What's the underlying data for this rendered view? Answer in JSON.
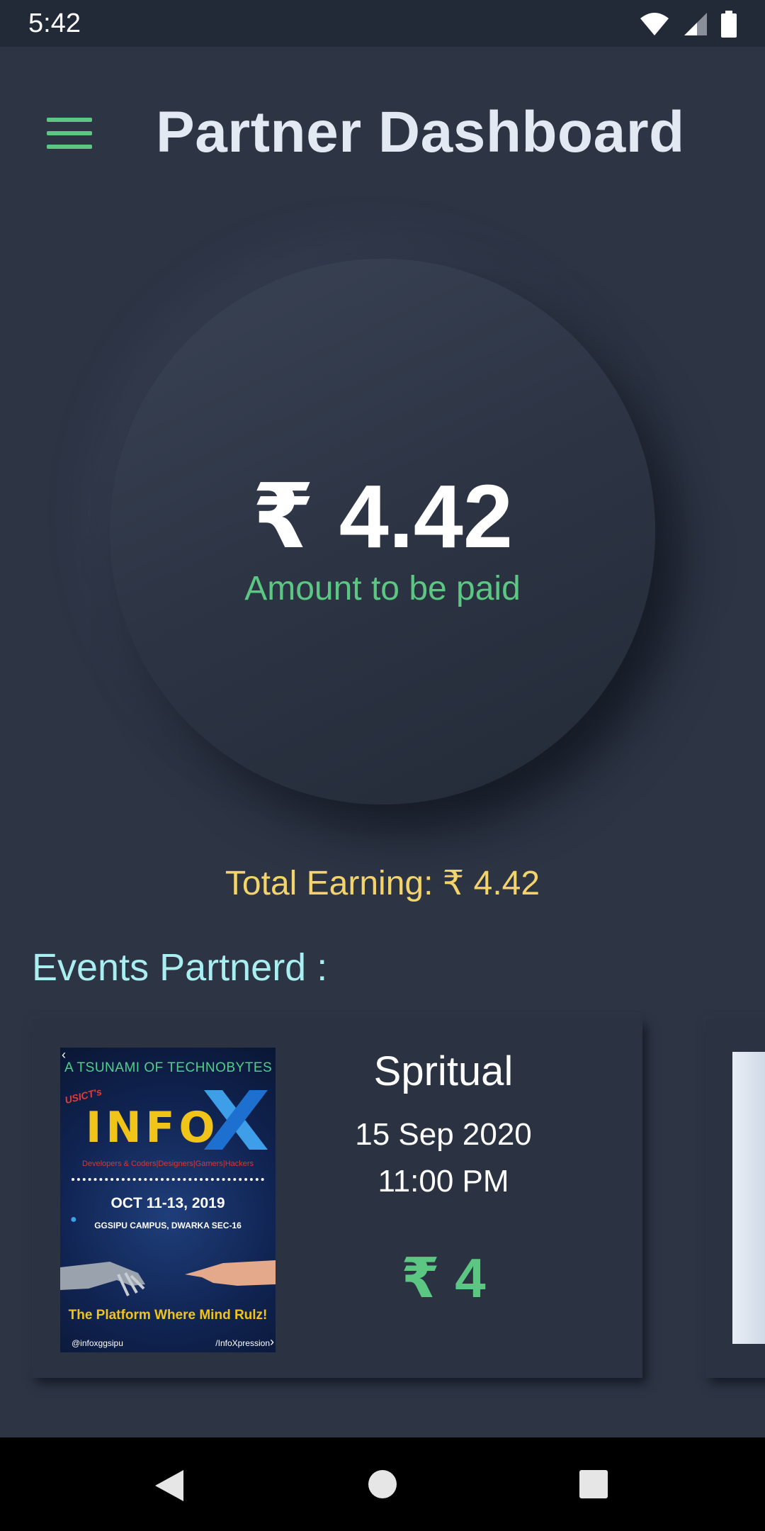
{
  "status_bar": {
    "time": "5:42",
    "icons": [
      "wifi-icon",
      "signal-icon",
      "battery-icon"
    ]
  },
  "app_bar": {
    "title": "Partner Dashboard",
    "menu_icon": "hamburger-menu-icon"
  },
  "balance": {
    "amount": "₹ 4.42",
    "label": "Amount to be paid"
  },
  "total_earning": "Total Earning: ₹ 4.42",
  "events_heading": "Events Partnerd :",
  "events": [
    {
      "name": "Spritual",
      "date": "15 Sep 2020",
      "time": "11:00 PM",
      "amount": "₹ 4",
      "poster": {
        "tagline_top": "A TSUNAMI OF TECHNOBYTES",
        "usict": "USICT's",
        "brand": "INFO",
        "roles": "Developers & Coders|Designers|Gamers|Hackers",
        "dates": "OCT 11-13, 2019",
        "venue": "GGSIPU CAMPUS, DWARKA SEC-16",
        "tagline": "The Platform Where Mind Rulz!",
        "instagram": "@infoxggsipu",
        "facebook": "/InfoXpression"
      }
    }
  ],
  "colors": {
    "background": "#2d3545",
    "accent_green": "#5cc783",
    "earning_yellow": "#f2d46a",
    "heading_cyan": "#a9eef0",
    "title": "#e3e9f3"
  }
}
